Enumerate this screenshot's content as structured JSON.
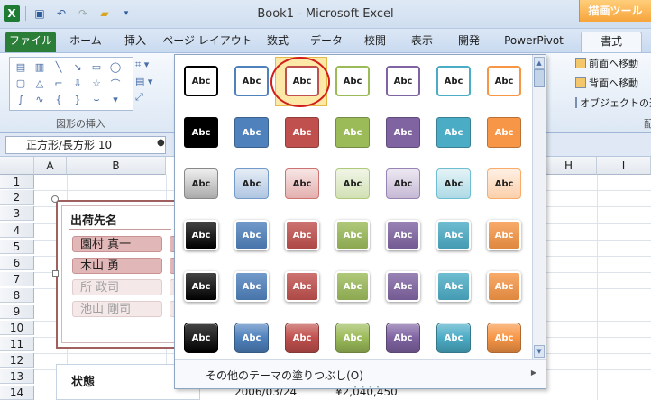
{
  "window": {
    "title": "Book1 - Microsoft Excel",
    "context_tab_group": "描画ツール"
  },
  "tabs": [
    "ファイル",
    "ホーム",
    "挿入",
    "ページ レイアウト",
    "数式",
    "データ",
    "校閲",
    "表示",
    "開発",
    "PowerPivot",
    "書式"
  ],
  "ribbon": {
    "insert_shapes_group": "図形の挿入",
    "arrange": {
      "bring_forward": "前面へ移動",
      "send_backward": "背面へ移動",
      "selection_pane": "オブジェクトの選",
      "group_label_partial": "配"
    }
  },
  "name_box": "正方形/長方形 10",
  "columns": [
    "A",
    "B",
    "H",
    "I"
  ],
  "rows": [
    "1",
    "2",
    "3",
    "4",
    "5",
    "6",
    "7",
    "8",
    "9",
    "10",
    "11",
    "12",
    "13",
    "14"
  ],
  "slicer1": {
    "title": "出荷先名",
    "items": [
      {
        "label": "園村 真一",
        "state": "selected"
      },
      {
        "label": "木山 勇",
        "state": "selected"
      },
      {
        "label": "所 政司",
        "state": "dim"
      },
      {
        "label": "池山 剛司",
        "state": "dim"
      }
    ]
  },
  "slicer2": {
    "title": "状態"
  },
  "cells": {
    "date": "2006/03/24",
    "amount": "¥2,040,450"
  },
  "gallery": {
    "swatch_label": "Abc",
    "more_fills": "その他のテーマの塗りつぶし(O)",
    "selected": {
      "row": 0,
      "col": 2
    },
    "theme_colors": [
      "#000000",
      "#4f81bd",
      "#c0504d",
      "#9bbb59",
      "#8064a2",
      "#4bacc6",
      "#f79646"
    ],
    "styles": [
      "outline",
      "solid",
      "soft",
      "grad",
      "grad",
      "glossy"
    ]
  },
  "icons": {
    "excel": "excel-logo-icon",
    "save": "save-icon",
    "undo": "undo-icon",
    "redo": "redo-icon",
    "open": "folder-icon"
  }
}
